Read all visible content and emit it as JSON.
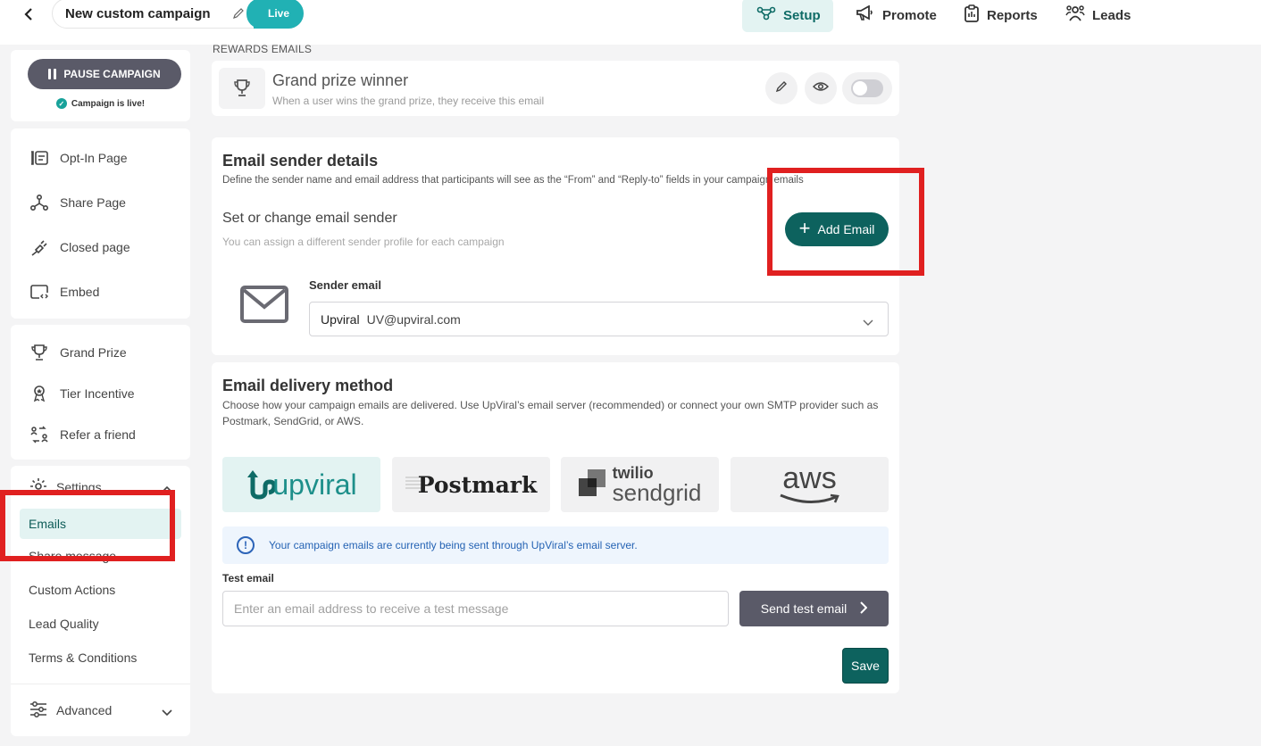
{
  "header": {
    "campaign_title": "New custom campaign",
    "status": "Live",
    "nav": [
      {
        "label": "Setup",
        "icon": "setup-icon"
      },
      {
        "label": "Promote",
        "icon": "megaphone-icon"
      },
      {
        "label": "Reports",
        "icon": "clipboard-icon"
      },
      {
        "label": "Leads",
        "icon": "people-icon"
      }
    ]
  },
  "sidebar": {
    "pause_label": "PAUSE CAMPAIGN",
    "live_status": "Campaign is live!",
    "pages": [
      {
        "label": "Opt-In Page",
        "icon": "opt-in-icon"
      },
      {
        "label": "Share Page",
        "icon": "share-icon"
      },
      {
        "label": "Closed page",
        "icon": "plug-icon"
      },
      {
        "label": "Embed",
        "icon": "embed-icon"
      }
    ],
    "incentives": [
      {
        "label": "Grand Prize",
        "icon": "trophy-icon"
      },
      {
        "label": "Tier Incentive",
        "icon": "medal-icon"
      },
      {
        "label": "Refer a friend",
        "icon": "refer-icon"
      }
    ],
    "settings": {
      "label": "Settings",
      "items": [
        "Emails",
        "Share message",
        "Custom Actions",
        "Lead Quality",
        "Terms & Conditions"
      ],
      "active": "Emails"
    },
    "advanced_label": "Advanced"
  },
  "rewards": {
    "section_label": "REWARDS EMAILS",
    "title": "Grand prize winner",
    "subtitle": "When a user wins the grand prize, they receive this email",
    "enabled": false
  },
  "sender": {
    "title": "Email sender details",
    "description": "Define the sender name and email address that participants will see as the “From” and “Reply-to” fields in your campaign emails",
    "set_title": "Set or change email sender",
    "set_sub": "You can assign a different sender profile for each campaign",
    "add_label": "Add Email",
    "field_label": "Sender email",
    "selected_name": "Upviral",
    "selected_email": "UV@upviral.com"
  },
  "delivery": {
    "title": "Email delivery method",
    "description": "Choose how your campaign emails are delivered. Use UpViral’s email server (recommended) or connect your own SMTP provider such as Postmark, SendGrid, or AWS.",
    "providers": {
      "upviral": "upviral",
      "postmark": "Postmark",
      "sendgrid_top": "twilio",
      "sendgrid_bottom": "sendgrid",
      "aws": "aws"
    },
    "selected_provider": "upviral",
    "info": "Your campaign emails are currently being sent through UpViral’s email server.",
    "test_label": "Test email",
    "test_placeholder": "Enter an email address to receive a test message",
    "send_label": "Send test email",
    "save_label": "Save"
  },
  "colors": {
    "accent": "#0d625e",
    "live": "#21b1b4",
    "highlight": "#e02020",
    "info": "#2563b4"
  }
}
